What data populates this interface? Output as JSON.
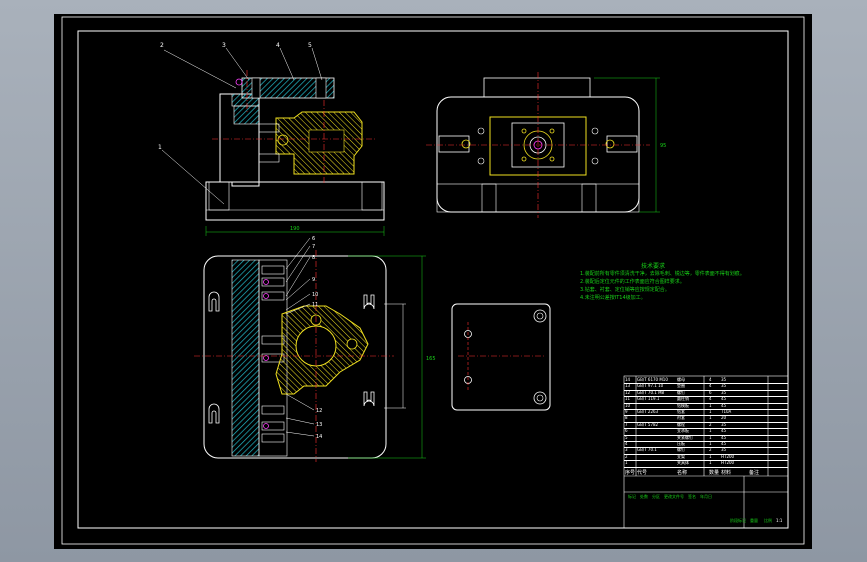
{
  "colors": {
    "background": "#000000",
    "frame": "#ffffff",
    "hatch": "#22b8c8",
    "centerline": "#ff3030",
    "yellow": "#f0e020",
    "magenta": "#ff40ff",
    "green": "#18d018"
  },
  "balloons_elevation": [
    "2",
    "3",
    "4",
    "5",
    "1"
  ],
  "balloons_plan": [
    "6",
    "7",
    "8",
    "9",
    "10",
    "11",
    "12",
    "13",
    "14"
  ],
  "dimension_width": "190",
  "dimension_height_side": "95",
  "dimension_plan_side": "165",
  "notes": {
    "title": "技术要求",
    "lines": [
      "1.装配前所有零件须清洗干净，去除毛刺、锐边等，零件表面不得有划痕。",
      "2.装配后定位元件的工作表面应符合图样要求。",
      "3.钻套、衬套、定位销等应按规定配合。",
      "4.未注明公差按IT14级加工。"
    ]
  },
  "title_block": {
    "header": [
      "序号",
      "代号",
      "名称",
      "数量",
      "材料",
      "备注"
    ],
    "rows": [
      [
        "14",
        "GB/T 6170 M10",
        "螺母",
        "4",
        "35",
        ""
      ],
      [
        "13",
        "GB/T 97.1 10",
        "垫圈",
        "4",
        "35",
        ""
      ],
      [
        "12",
        "GB/T 70.1 M8",
        "螺钉",
        "6",
        "35",
        ""
      ],
      [
        "11",
        "GB/T 119.1",
        "圆柱销",
        "4",
        "45",
        ""
      ],
      [
        "10",
        "",
        "钻模板",
        "1",
        "45",
        ""
      ],
      [
        "9",
        "GB/T 2263",
        "钻套",
        "1",
        "T10A",
        ""
      ],
      [
        "8",
        "",
        "衬套",
        "1",
        "20",
        ""
      ],
      [
        "7",
        "GB/T 5782",
        "螺栓",
        "2",
        "35",
        ""
      ],
      [
        "6",
        "",
        "支承板",
        "1",
        "45",
        ""
      ],
      [
        "5",
        "",
        "夹紧螺钉",
        "1",
        "45",
        ""
      ],
      [
        "4",
        "",
        "压板",
        "1",
        "45",
        ""
      ],
      [
        "3",
        "GB/T 70.1",
        "螺钉",
        "2",
        "35",
        ""
      ],
      [
        "2",
        "",
        "支架",
        "1",
        "HT200",
        ""
      ],
      [
        "1",
        "",
        "夹具体",
        "1",
        "HT200",
        ""
      ]
    ],
    "bottom_left": [
      "标记",
      "处数",
      "分区",
      "更改文件号",
      "签名",
      "年月日"
    ],
    "bottom_mid": [
      "阶段标记",
      "重量",
      "比例"
    ],
    "scale": "1:1"
  }
}
